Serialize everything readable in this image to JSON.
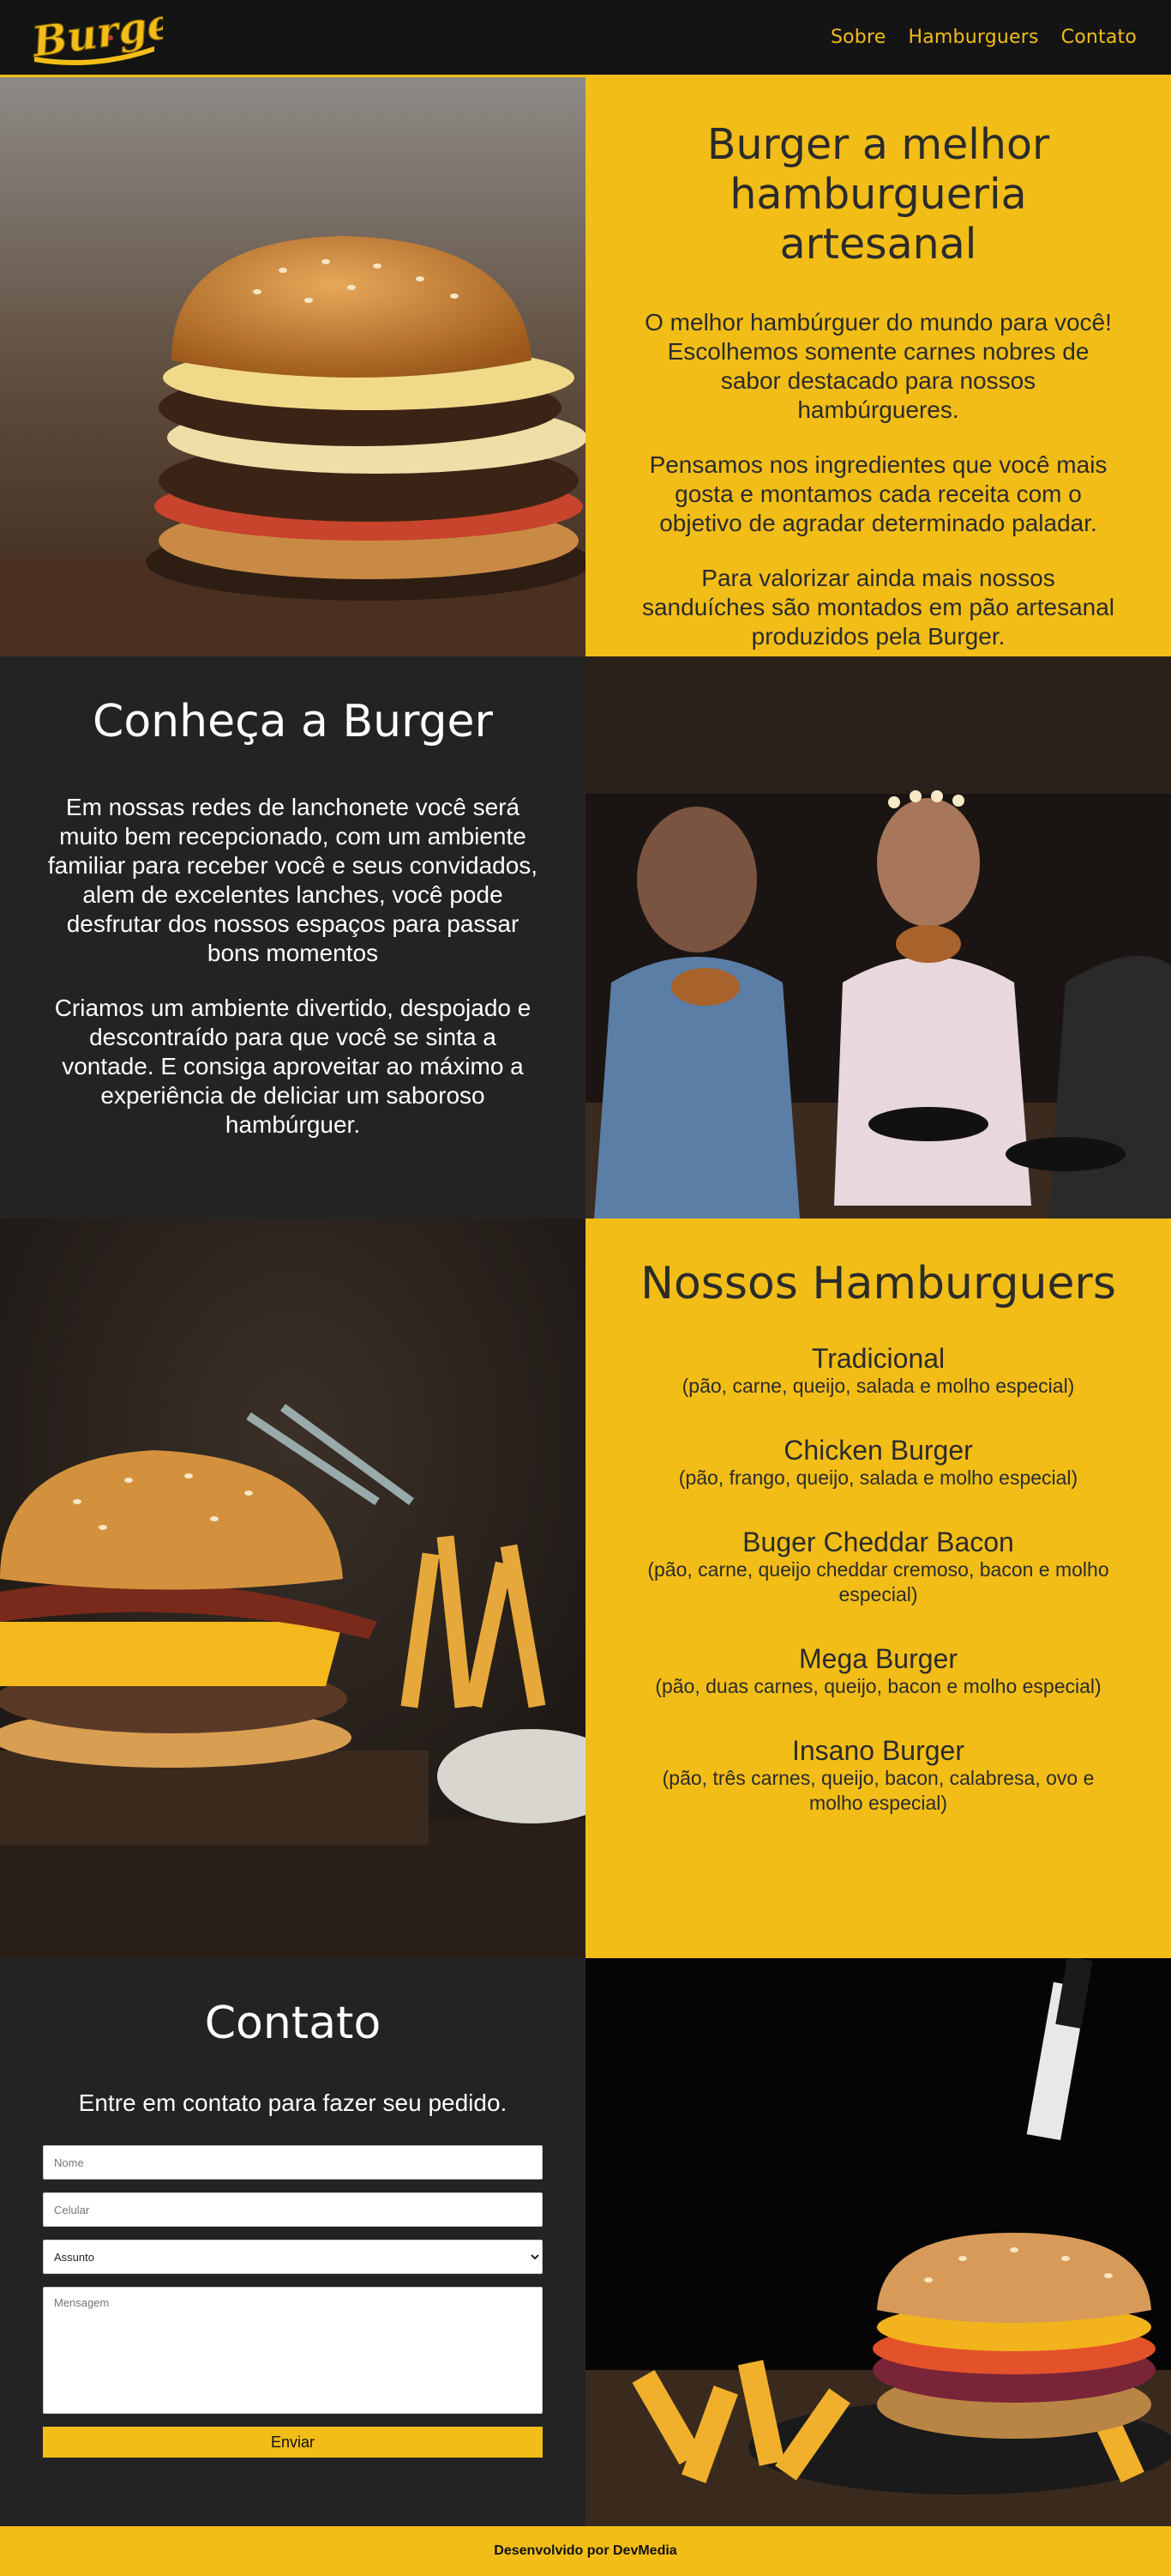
{
  "header": {
    "logo_text": "Burger",
    "nav": [
      {
        "label": "Sobre"
      },
      {
        "label": "Hamburguers"
      },
      {
        "label": "Contato"
      }
    ]
  },
  "about": {
    "title": "Burger a melhor hamburgueria artesanal",
    "paragraphs": [
      "O melhor hambúrguer do mundo para você! Escolhemos somente carnes nobres de sabor destacado para nossos hambúrgueres.",
      "Pensamos nos ingredientes que você mais gosta e montamos cada receita com o objetivo de agradar determinado paladar.",
      "Para valorizar ainda mais nossos sanduíches são montados em pão artesanal produzidos pela Burger."
    ]
  },
  "know": {
    "title": "Conheça a Burger",
    "paragraphs": [
      "Em nossas redes de lanchonete você será muito bem recepcionado, com um ambiente familiar para receber você e seus convidados, alem de excelentes lanches, você pode desfrutar dos nossos espaços para passar bons momentos",
      "Criamos um ambiente divertido, despojado e descontraído para que você se sinta a vontade. E consiga aproveitar ao máximo a experiência de deliciar um saboroso hambúrguer."
    ]
  },
  "menu": {
    "title": "Nossos Hamburguers",
    "items": [
      {
        "name": "Tradicional",
        "desc": "(pão, carne, queijo, salada e molho especial)"
      },
      {
        "name": "Chicken Burger",
        "desc": "(pão, frango, queijo, salada e molho especial)"
      },
      {
        "name": "Buger Cheddar Bacon",
        "desc": "(pão, carne, queijo cheddar cremoso, bacon e molho especial)"
      },
      {
        "name": "Mega Burger",
        "desc": "(pão, duas carnes, queijo, bacon e molho especial)"
      },
      {
        "name": "Insano Burger",
        "desc": "(pão, três carnes, queijo, bacon, calabresa, ovo e molho especial)"
      }
    ]
  },
  "contact": {
    "title": "Contato",
    "lead": "Entre em contato para fazer seu pedido.",
    "name_placeholder": "Nome",
    "phone_placeholder": "Celular",
    "subject_selected": "Assunto",
    "message_placeholder": "Mensagem",
    "submit_label": "Enviar"
  },
  "footer": {
    "text": "Desenvolvido por DevMedia"
  },
  "colors": {
    "brand_yellow": "#f2bd17",
    "dark_bg": "#232323",
    "header_bg": "#141414"
  }
}
